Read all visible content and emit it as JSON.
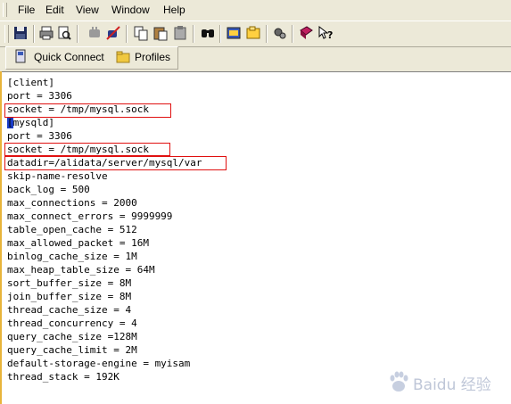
{
  "menu": {
    "file": "File",
    "edit": "Edit",
    "view": "View",
    "window": "Window",
    "help": "Help"
  },
  "toolbar": {
    "icons": [
      "save-icon",
      "print-icon",
      "print-preview-icon",
      "connect-icon",
      "disconnect-icon",
      "copy-icon",
      "paste-icon",
      "clipboard-icon",
      "find-icon",
      "file-transfer-icon",
      "new-profile-icon",
      "settings-icon",
      "help-book-icon",
      "context-help-icon"
    ]
  },
  "quick_bar": {
    "quick_connect": "Quick Connect",
    "profiles": "Profiles"
  },
  "editor": {
    "lines": [
      "[client]",
      "port = 3306",
      "socket = /tmp/mysql.sock",
      "[mysqld]",
      "port = 3306",
      "socket = /tmp/mysql.sock",
      "datadir=/alidata/server/mysql/var",
      "skip-name-resolve",
      "back_log = 500",
      "max_connections = 2000",
      "max_connect_errors = 9999999",
      "table_open_cache = 512",
      "max_allowed_packet = 16M",
      "binlog_cache_size = 1M",
      "max_heap_table_size = 64M",
      "sort_buffer_size = 8M",
      "join_buffer_size = 8M",
      "thread_cache_size = 4",
      "thread_concurrency = 4",
      "query_cache_size =128M",
      "query_cache_limit = 2M",
      "default-storage-engine = myisam",
      "thread_stack = 192K"
    ]
  },
  "watermark": "Baidu 经验",
  "colors": {
    "chrome": "#ece9d8",
    "highlight_box": "#e01010",
    "cursor": "#1a3cc8"
  }
}
